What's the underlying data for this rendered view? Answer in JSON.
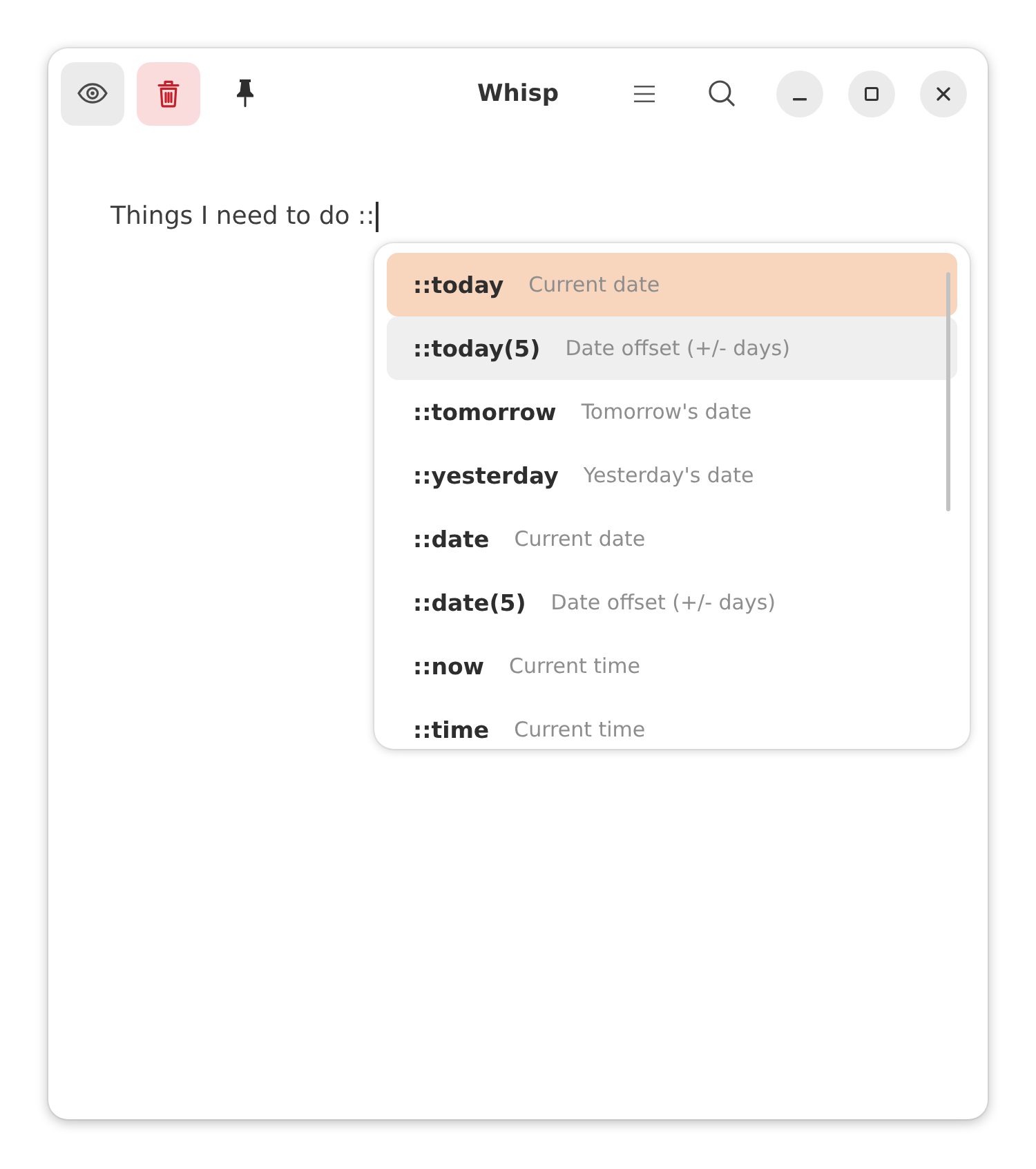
{
  "window": {
    "title": "Whisp"
  },
  "header": {
    "preview_toggle": {
      "on": true
    },
    "delete_button": {
      "highlighted": true
    },
    "pin_toggle": {
      "on": false
    }
  },
  "editor": {
    "value": "Things I need to do ::"
  },
  "suggestions": [
    {
      "keyword": "::today",
      "description": "Current date",
      "selected": true,
      "hovered": false
    },
    {
      "keyword": "::today(5)",
      "description": "Date offset (+/- days)",
      "selected": false,
      "hovered": true
    },
    {
      "keyword": "::tomorrow",
      "description": "Tomorrow's date",
      "selected": false,
      "hovered": false
    },
    {
      "keyword": "::yesterday",
      "description": "Yesterday's date",
      "selected": false,
      "hovered": false
    },
    {
      "keyword": "::date",
      "description": "Current date",
      "selected": false,
      "hovered": false
    },
    {
      "keyword": "::date(5)",
      "description": "Date offset (+/- days)",
      "selected": false,
      "hovered": false
    },
    {
      "keyword": "::now",
      "description": "Current time",
      "selected": false,
      "hovered": false
    },
    {
      "keyword": "::time",
      "description": "Current time",
      "selected": false,
      "hovered": false
    }
  ]
}
